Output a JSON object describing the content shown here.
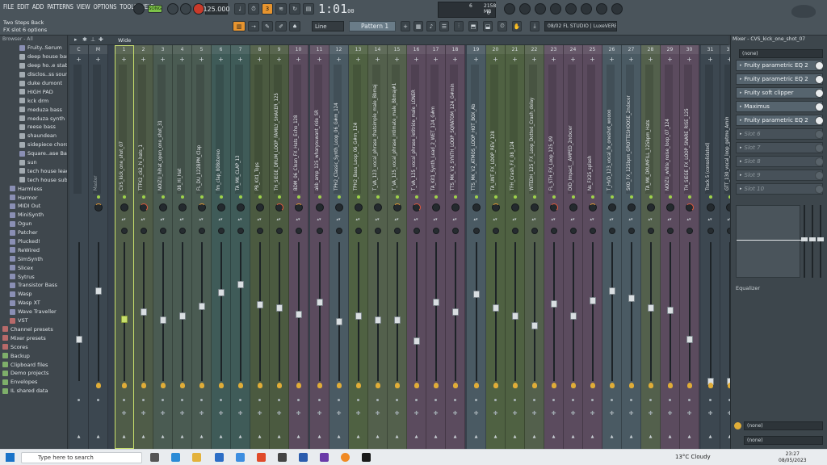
{
  "menu": [
    "FILE",
    "EDIT",
    "ADD",
    "PATTERNS",
    "VIEW",
    "OPTIONS",
    "TOOLS",
    "HELP"
  ],
  "hint_top": "Two Steps Back",
  "hint_sub": "FX slot 6 options",
  "toolbar": {
    "song_label": "SONG",
    "tempo": "125.000",
    "time_main": "1:01",
    "time_sub": "00",
    "snap": "Line",
    "pattern": "Pattern 1",
    "hint_bar": "08/02  FL STUDIO | LuxeVERB",
    "cpu_val1": "6",
    "cpu_val2": "2158 MB",
    "cpu_val3": "0"
  },
  "browser": {
    "header_left": "Browser - All",
    "items": [
      {
        "label": "Fruity..Serum",
        "icon": "plugin-icon",
        "lvl": "sub"
      },
      {
        "label": "deep house bass",
        "icon": "sine-icon",
        "lvl": "sub"
      },
      {
        "label": "deep ho..e stabs",
        "icon": "sine-icon",
        "lvl": "sub"
      },
      {
        "label": "disclos..ss sound",
        "icon": "sine-icon",
        "lvl": "sub"
      },
      {
        "label": "duke dumont",
        "icon": "sine-icon",
        "lvl": "sub"
      },
      {
        "label": "HIGH PAD",
        "icon": "sine-icon",
        "lvl": "sub"
      },
      {
        "label": "kck drm",
        "icon": "sine-icon",
        "lvl": "sub"
      },
      {
        "label": "meduza bass",
        "icon": "sine-icon",
        "lvl": "sub"
      },
      {
        "label": "meduza synth",
        "icon": "sine-icon",
        "lvl": "sub"
      },
      {
        "label": "reese bass",
        "icon": "sine-icon",
        "lvl": "sub"
      },
      {
        "label": "shaundean",
        "icon": "sine-icon",
        "lvl": "sub"
      },
      {
        "label": "sidepiece chords",
        "icon": "sine-icon",
        "lvl": "sub"
      },
      {
        "label": "Square..ase Bass",
        "icon": "plugin-icon",
        "lvl": "sub"
      },
      {
        "label": "sun",
        "icon": "sine-icon",
        "lvl": "sub"
      },
      {
        "label": "tech house lead",
        "icon": "sine-icon",
        "lvl": "sub"
      },
      {
        "label": "tech house sub",
        "icon": "sine-icon",
        "lvl": "sub"
      },
      {
        "label": "Harmless",
        "icon": "plugin-icon",
        "lvl": "ind"
      },
      {
        "label": "Harmor",
        "icon": "plugin-icon",
        "lvl": "ind"
      },
      {
        "label": "MIDI Out",
        "icon": "plugin-icon",
        "lvl": "ind"
      },
      {
        "label": "MiniSynth",
        "icon": "plugin-icon",
        "lvl": "ind"
      },
      {
        "label": "Ogun",
        "icon": "plugin-icon",
        "lvl": "ind"
      },
      {
        "label": "Patcher",
        "icon": "plugin-icon",
        "lvl": "ind"
      },
      {
        "label": "Plucked!",
        "icon": "plugin-icon",
        "lvl": "ind"
      },
      {
        "label": "ReWired",
        "icon": "plugin-icon",
        "lvl": "ind"
      },
      {
        "label": "SimSynth",
        "icon": "plugin-icon",
        "lvl": "ind"
      },
      {
        "label": "Slicex",
        "icon": "plugin-icon",
        "lvl": "ind"
      },
      {
        "label": "Sytrus",
        "icon": "plugin-icon",
        "lvl": "ind"
      },
      {
        "label": "Transistor Bass",
        "icon": "plugin-icon",
        "lvl": "ind"
      },
      {
        "label": "Wasp",
        "icon": "plugin-icon",
        "lvl": "ind"
      },
      {
        "label": "Wasp XT",
        "icon": "plugin-icon",
        "lvl": "ind"
      },
      {
        "label": "Wave Traveller",
        "icon": "plugin-icon",
        "lvl": "ind"
      },
      {
        "label": "VST",
        "icon": "vst-icon",
        "lvl": "ind"
      },
      {
        "label": "Channel presets",
        "icon": "vst-icon",
        "lvl": "top"
      },
      {
        "label": "Mixer presets",
        "icon": "vst-icon",
        "lvl": "top"
      },
      {
        "label": "Scores",
        "icon": "vst-icon",
        "lvl": "top"
      },
      {
        "label": "Backup",
        "icon": "folder-icon",
        "lvl": "top"
      },
      {
        "label": "Clipboard files",
        "icon": "folder-icon",
        "lvl": "top"
      },
      {
        "label": "Demo projects",
        "icon": "folder-icon",
        "lvl": "top"
      },
      {
        "label": "Envelopes",
        "icon": "folder-icon",
        "lvl": "top"
      },
      {
        "label": "IL shared data",
        "icon": "folder-icon",
        "lvl": "top"
      }
    ]
  },
  "mixer": {
    "view_label": "Wide",
    "title": "Mixer - CVS_kick_one_shot_07",
    "tracks": [
      {
        "num": "C",
        "name": "",
        "fader": 0.3,
        "color": "#3c4750"
      },
      {
        "num": "M",
        "name": "Master",
        "fader": 0.65,
        "color": "#3c4750"
      },
      {
        "num": "1",
        "name": "CVS_kick_one_shot_07",
        "fader": 0.45,
        "color": "#4f5c48"
      },
      {
        "num": "2",
        "name": "TTFK2_ck2_hi_hats_1",
        "fader": 0.5,
        "color": "#4f5c48"
      },
      {
        "num": "3",
        "name": "NOIZU_hihat_open_one_shot_31",
        "fader": 0.44,
        "color": "#4a5b52"
      },
      {
        "num": "4",
        "name": "08_Hi_Hat",
        "fader": 0.47,
        "color": "#4a5b52"
      },
      {
        "num": "5",
        "name": "FL_DU_122BPM_Clap",
        "fader": 0.54,
        "color": "#4a5b52"
      },
      {
        "num": "6",
        "name": "fm_clap_808stereo",
        "fader": 0.64,
        "color": "#3f5b58"
      },
      {
        "num": "7",
        "name": "TA_MK_CLAP_13",
        "fader": 0.7,
        "color": "#3f5b58"
      },
      {
        "num": "8",
        "name": "PB_Kit1_Tops",
        "fader": 0.55,
        "color": "#4b5a40"
      },
      {
        "num": "9",
        "name": "TH_SIEGE_DRUM_LOOP_FAMILY_SHAKER_125",
        "fader": 0.53,
        "color": "#4b5a40"
      },
      {
        "num": "10",
        "name": "BDM_06_Clean_FX_Hats_Echo_128",
        "fader": 0.48,
        "color": "#5b4b5e"
      },
      {
        "num": "11",
        "name": "akb_amp_125_wharyouwant_ride_SR",
        "fader": 0.57,
        "color": "#5b4b5e"
      },
      {
        "num": "12",
        "name": "TPH2_Classic_Synth_Loop_06_G#m_124",
        "fader": 0.43,
        "color": "#4a5a63"
      },
      {
        "num": "13",
        "name": "TPH2_Bass_Loop_06_G#m_124",
        "fader": 0.47,
        "color": "#4f6142"
      },
      {
        "num": "14",
        "name": "T_VA_123_vocal_phrase_thatsimple_male_Bbmaj",
        "fader": 0.44,
        "color": "#53604c"
      },
      {
        "num": "15",
        "name": "T_VA_125_vocal_phrase_intimate_male_Bbmaj#1",
        "fader": 0.44,
        "color": "#53604c"
      },
      {
        "num": "16",
        "name": "T_VA_125_vocal_phrase_letitride_male_LONER",
        "fader": 0.29,
        "color": "#5b4b5e"
      },
      {
        "num": "17",
        "name": "TA_Kit1_Synth_Lead_2_WET_124_G#m",
        "fader": 0.57,
        "color": "#5b4b5e"
      },
      {
        "num": "18",
        "name": "TTS_MK_V2_SYNTH_LOOP_SQRATOM_124_G#min",
        "fader": 0.5,
        "color": "#5b4b5e"
      },
      {
        "num": "19",
        "name": "TTS_MK_V2_ATMOS_LOOP_HOT_BOX_Ab",
        "fader": 0.63,
        "color": "#4a5a63"
      },
      {
        "num": "20",
        "name": "TA_UNT_FX_LOOP_REV_128",
        "fader": 0.53,
        "color": "#4f6142"
      },
      {
        "num": "21",
        "name": "TFH_Crash_FX_08_124",
        "fader": 0.47,
        "color": "#4f6142"
      },
      {
        "num": "22",
        "name": "WTEDH_125_FX_Loop_Dotted_Crash_delay",
        "fader": 0.4,
        "color": "#53604c"
      },
      {
        "num": "23",
        "name": "FL_STH_FX_Loop_125_09",
        "fader": 0.56,
        "color": "#5b4b5e"
      },
      {
        "num": "24",
        "name": "DID_Impact__AMPED_2ndxcer",
        "fader": 0.47,
        "color": "#5b4b5e"
      },
      {
        "num": "25",
        "name": "Ns_FX25_splash",
        "fader": 0.58,
        "color": "#5b4b5e"
      },
      {
        "num": "26",
        "name": "T_HVD_123_vocal_fx_oneshot_woooo",
        "fader": 0.65,
        "color": "#4a5a63"
      },
      {
        "num": "27",
        "name": "SKO_FX_125bpm_GROTTESHOOSE_2ndxcer",
        "fader": 0.6,
        "color": "#4a5a63"
      },
      {
        "num": "28",
        "name": "TA_MK_DRUMFILL_125bpm_Hats",
        "fader": 0.53,
        "color": "#53604c"
      },
      {
        "num": "29",
        "name": "NOIZU_white_noise_loop_07_124",
        "fader": 0.51,
        "color": "#5b4b5e"
      },
      {
        "num": "30",
        "name": "TH_SIEGE_FX_LOOP_SNARE_RISE_125",
        "fader": 0.3,
        "color": "#5b4b5e"
      },
      {
        "num": "31",
        "name": "Track 5 (consolidated)",
        "fader": 0.0,
        "color": "#3c4750"
      },
      {
        "num": "32",
        "name": "GTT_130_vocal_loop_getme_Amin",
        "fader": 0.0,
        "color": "#3c4750"
      }
    ]
  },
  "fx": {
    "input": "(none)",
    "slots": [
      {
        "label": "Fruity parametric EQ 2",
        "empty": false
      },
      {
        "label": "Fruity parametric EQ 2",
        "empty": false
      },
      {
        "label": "Fruity soft clipper",
        "empty": false
      },
      {
        "label": "Maximus",
        "empty": false
      },
      {
        "label": "Fruity parametric EQ 2",
        "empty": false
      },
      {
        "label": "Slot 6",
        "empty": true
      },
      {
        "label": "Slot 7",
        "empty": true
      },
      {
        "label": "Slot 8",
        "empty": true
      },
      {
        "label": "Slot 9",
        "empty": true
      },
      {
        "label": "Slot 10",
        "empty": true
      }
    ],
    "eq_label": "Equalizer",
    "out1": "(none)",
    "out2": "(none)"
  },
  "taskbar": {
    "search_placeholder": "Type here to search",
    "weather": "13°C  Cloudy",
    "time": "23:27",
    "date": "08/05/2023"
  }
}
